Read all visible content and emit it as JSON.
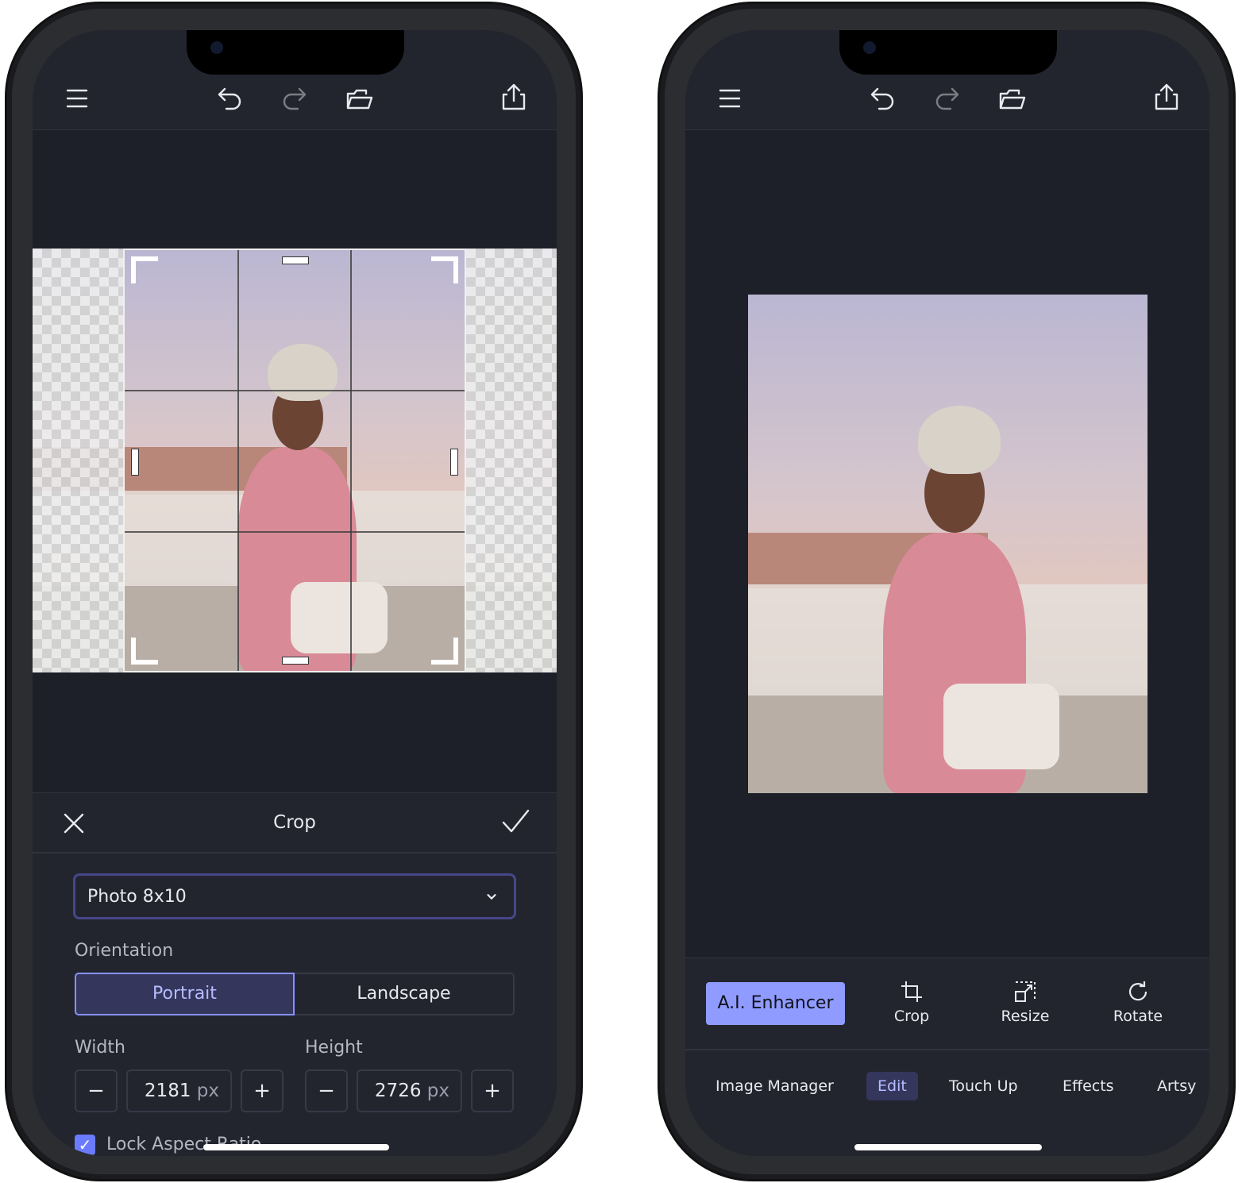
{
  "left_phone": {
    "toolbar": {
      "icons": [
        "menu-icon",
        "undo-icon",
        "redo-icon",
        "open-folder-icon",
        "share-icon"
      ]
    },
    "crop_panel": {
      "title": "Crop",
      "preset": "Photo 8x10",
      "orientation_label": "Orientation",
      "orientation_options": [
        "Portrait",
        "Landscape"
      ],
      "orientation_selected": "Portrait",
      "width_label": "Width",
      "width_value": "2181",
      "width_unit": "px",
      "height_label": "Height",
      "height_value": "2726",
      "height_unit": "px",
      "minus": "−",
      "plus": "+",
      "lock_label": "Lock Aspect Ratio",
      "lock_checked": true
    }
  },
  "right_phone": {
    "toolbar": {
      "icons": [
        "menu-icon",
        "undo-icon",
        "redo-icon",
        "open-folder-icon",
        "share-icon"
      ]
    },
    "tools": {
      "ai_enhancer": "A.I. Enhancer",
      "crop": "Crop",
      "resize": "Resize",
      "rotate": "Rotate"
    },
    "tabs": [
      "Image Manager",
      "Edit",
      "Touch Up",
      "Effects",
      "Artsy"
    ],
    "active_tab": "Edit"
  },
  "colors": {
    "accent": "#8f9bff",
    "selected_bg": "#35365c",
    "bg": "#1e2029",
    "panel": "#23252e"
  }
}
